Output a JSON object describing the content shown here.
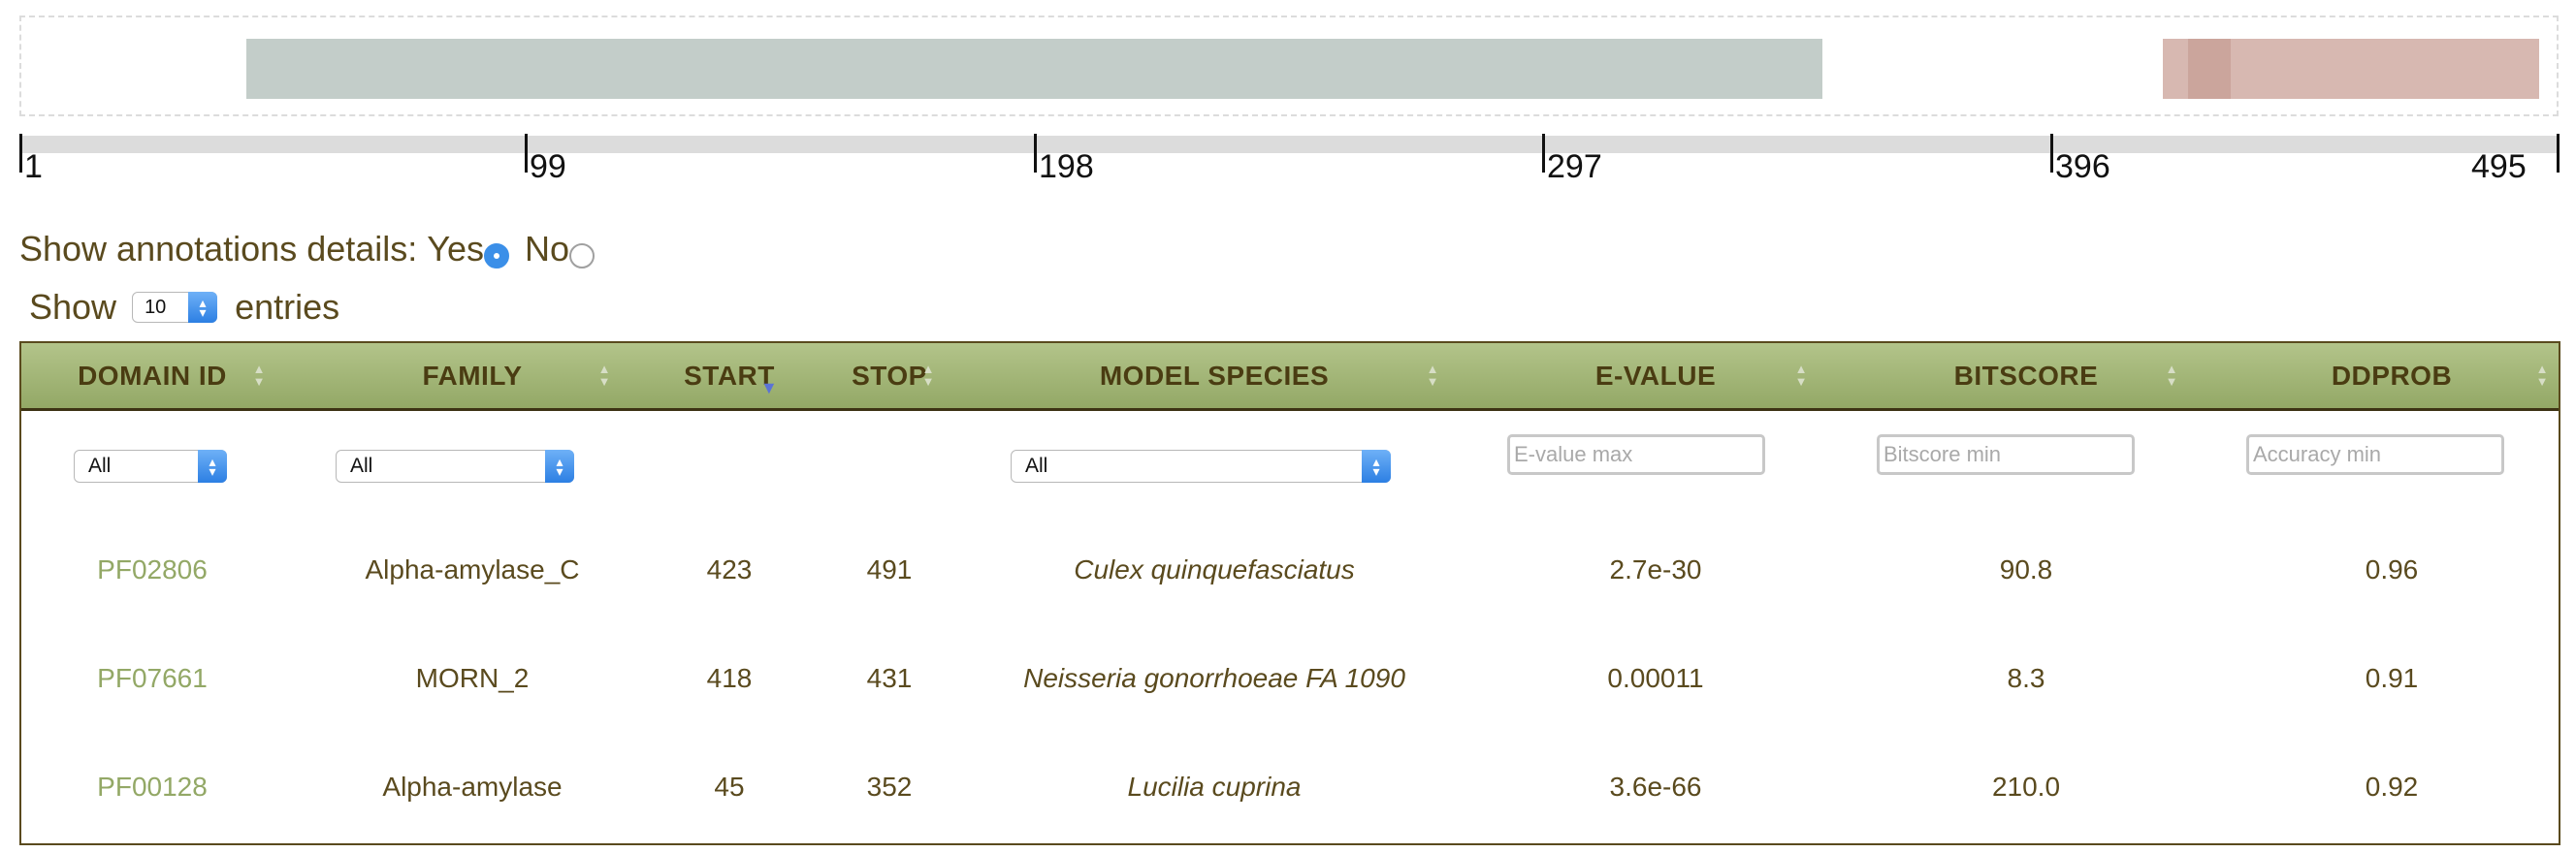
{
  "ruler": {
    "ticks": [
      "1",
      "99",
      "198",
      "297",
      "396",
      "495"
    ]
  },
  "annotations_toggle": {
    "label": "Show annotations details:",
    "yes_label": "Yes",
    "no_label": "No",
    "selected": "Yes"
  },
  "length_menu": {
    "show_label": "Show",
    "value": "10",
    "entries_label": "entries"
  },
  "table": {
    "columns": [
      "DOMAIN ID",
      "FAMILY",
      "START",
      "STOP",
      "MODEL SPECIES",
      "E-VALUE",
      "BITSCORE",
      "DDPROB"
    ],
    "filters": {
      "domain_id": "All",
      "family": "All",
      "model_species": "All",
      "evalue_placeholder": "E-value max",
      "bitscore_placeholder": "Bitscore min",
      "ddprob_placeholder": "Accuracy min"
    },
    "rows": [
      {
        "domain_id": "PF02806",
        "family": "Alpha-amylase_C",
        "start": "423",
        "stop": "491",
        "species": "Culex quinquefasciatus",
        "evalue": "2.7e-30",
        "bitscore": "90.8",
        "ddprob": "0.96"
      },
      {
        "domain_id": "PF07661",
        "family": "MORN_2",
        "start": "418",
        "stop": "431",
        "species": "Neisseria gonorrhoeae FA 1090",
        "evalue": "0.00011",
        "bitscore": "8.3",
        "ddprob": "0.91"
      },
      {
        "domain_id": "PF00128",
        "family": "Alpha-amylase",
        "start": "45",
        "stop": "352",
        "species": "Lucilia cuprina",
        "evalue": "3.6e-66",
        "bitscore": "210.0",
        "ddprob": "0.92"
      }
    ]
  },
  "colors": {
    "domain_grey": "#c3cdc9",
    "domain_rose": "#d7b8b1",
    "header_green": "#a3b677",
    "link_green": "#93a866",
    "text_brown": "#5a4a1e"
  }
}
